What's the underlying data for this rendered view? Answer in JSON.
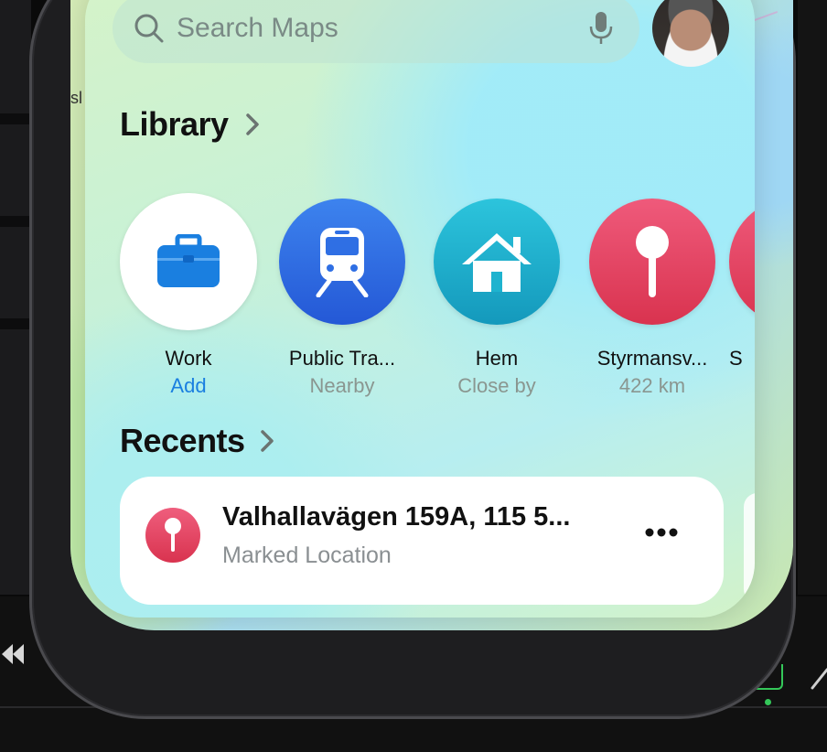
{
  "search": {
    "placeholder": "Search Maps"
  },
  "map": {
    "label_fragment": "sl"
  },
  "library": {
    "title": "Library",
    "items": [
      {
        "label": "Work",
        "sublabel": "Add",
        "icon": "briefcase-icon",
        "color": "#ffffff"
      },
      {
        "label": "Public Tra...",
        "sublabel": "Nearby",
        "icon": "train-icon",
        "color": "#2f6fe4"
      },
      {
        "label": "Hem",
        "sublabel": "Close by",
        "icon": "house-icon",
        "color": "#1eb3cf"
      },
      {
        "label": "Styrmansv...",
        "sublabel": "422 km",
        "icon": "pin-icon",
        "color": "#e63d5c"
      },
      {
        "label": "S",
        "sublabel": "",
        "icon": "pin-icon",
        "color": "#e63d5c"
      }
    ]
  },
  "recents": {
    "title": "Recents",
    "items": [
      {
        "title": "Valhallavägen 159A, 115 5...",
        "subtitle": "Marked Location",
        "icon": "pin-icon"
      }
    ]
  },
  "colors": {
    "accent": "#1a7fe0",
    "pin": "#e63d5c",
    "transit": "#2f6fe4",
    "home": "#1eb3cf"
  }
}
